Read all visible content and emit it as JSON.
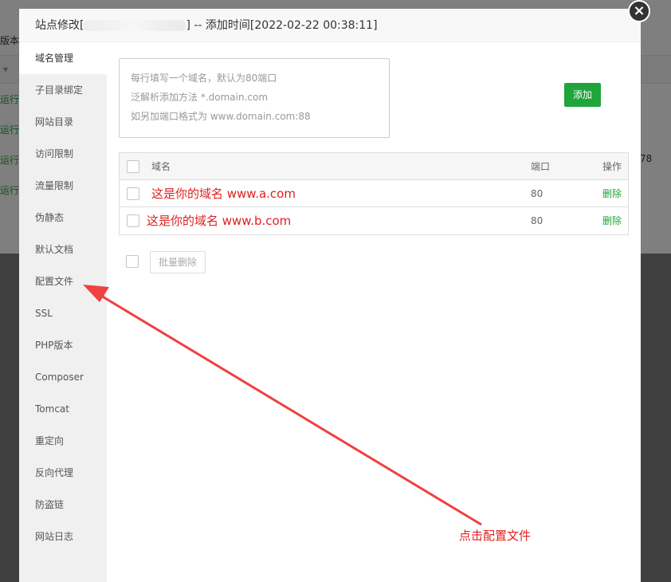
{
  "background": {
    "col_header": "版本",
    "rows": [
      {
        "status": "运行中▶"
      },
      {
        "status": "运行中▶"
      },
      {
        "status": "运行中▶"
      },
      {
        "status": "运行中▶"
      }
    ],
    "right_value": "78"
  },
  "modal": {
    "title_prefix": "站点修改[",
    "title_suffix": "] -- 添加时间[2022-02-22 00:38:11]",
    "close_label": "×"
  },
  "sidebar": {
    "items": [
      {
        "label": "域名管理"
      },
      {
        "label": "子目录绑定"
      },
      {
        "label": "网站目录"
      },
      {
        "label": "访问限制"
      },
      {
        "label": "流量限制"
      },
      {
        "label": "伪静态"
      },
      {
        "label": "默认文档"
      },
      {
        "label": "配置文件"
      },
      {
        "label": "SSL"
      },
      {
        "label": "PHP版本"
      },
      {
        "label": "Composer"
      },
      {
        "label": "Tomcat"
      },
      {
        "label": "重定向"
      },
      {
        "label": "反向代理"
      },
      {
        "label": "防盗链"
      },
      {
        "label": "网站日志"
      }
    ]
  },
  "domain_input": {
    "placeholder_lines": [
      "每行填写一个域名，默认为80端口",
      "泛解析添加方法 *.domain.com",
      "如另加端口格式为 www.domain.com:88"
    ]
  },
  "add_button": "添加",
  "table": {
    "headers": {
      "domain": "域名",
      "port": "端口",
      "action": "操作"
    },
    "rows": [
      {
        "domain": "这是你的域名 www.a.com",
        "port": "80",
        "action": "删除"
      },
      {
        "domain": "这是你的域名 www.b.com",
        "port": "80",
        "action": "删除"
      }
    ]
  },
  "batch_delete": "批量删除",
  "annotation": "点击配置文件",
  "colors": {
    "accent": "#20a53a",
    "annotation": "#e02020"
  }
}
